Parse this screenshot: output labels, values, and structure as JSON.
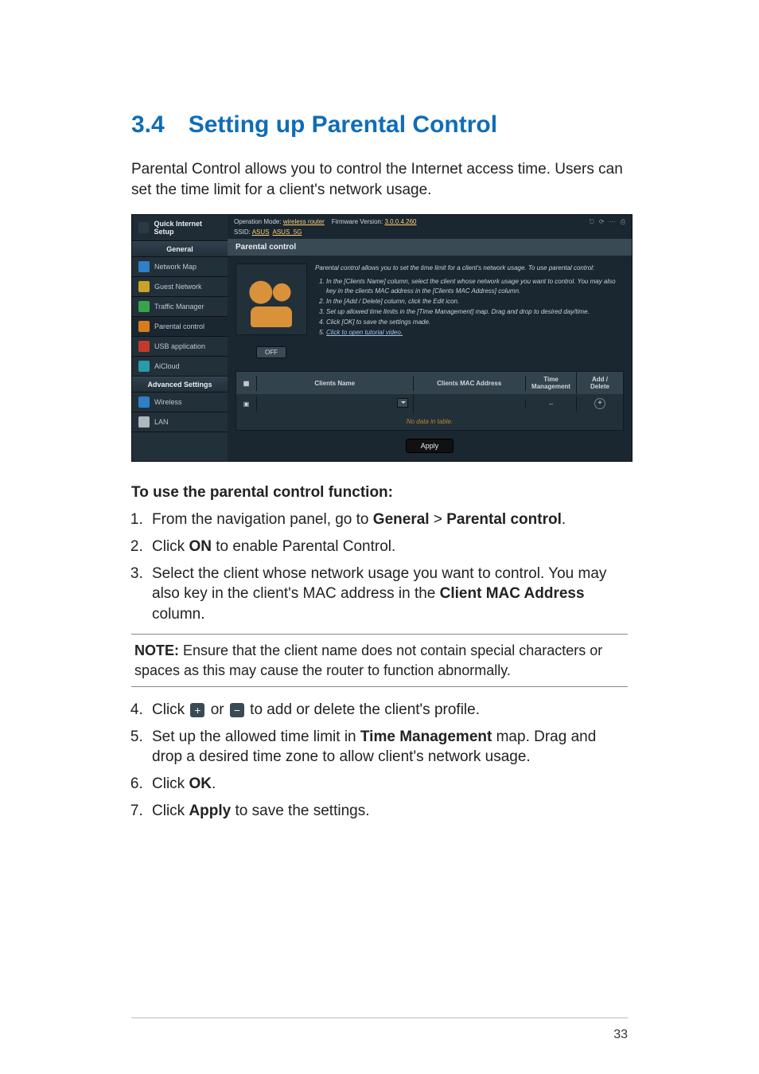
{
  "heading": "3.4 Setting up Parental Control",
  "intro": "Parental Control allows you to control the Internet access time. Users can set the time limit for a client's network usage.",
  "screenshot": {
    "quick_setup": "Quick Internet Setup",
    "header": {
      "op_mode_label": "Operation Mode:",
      "op_mode_value": "wireless router",
      "fw_label": "Firmware Version:",
      "fw_value": "3.0.0.4.260",
      "ssid_label": "SSID:",
      "ssid1": "ASUS",
      "ssid2": "ASUS_5G"
    },
    "sidebar": {
      "general_label": "General",
      "items": [
        "Network Map",
        "Guest Network",
        "Traffic Manager",
        "Parental control",
        "USB application",
        "AiCloud"
      ],
      "advanced_label": "Advanced Settings",
      "adv_items": [
        "Wireless",
        "LAN"
      ]
    },
    "panel_title": "Parental control",
    "desc_intro": "Parental control allows you to set the time limit for a client's network usage. To use parental control:",
    "desc_steps": [
      "In the [Clients Name] column, select the client whose network usage you want to control. You may also key in the clients MAC address in the [Clients MAC Address] column.",
      "In the [Add / Delete] column, click the Edit icon.",
      "Set up allowed time limits in the [Time Management] map. Drag and drop to desired day/time.",
      "Click [OK] to save the settings made.",
      "Click to open tutorial video."
    ],
    "toggle": "OFF",
    "table": {
      "cols": [
        "",
        "Clients Name",
        "Clients MAC Address",
        "Time Management",
        "Add / Delete"
      ],
      "empty": "No data in table.",
      "time_placeholder": "--"
    },
    "apply": "Apply"
  },
  "subhead": "To use the parental control function:",
  "steps_a": [
    {
      "pre": "From the navigation panel, go to ",
      "b1": "General",
      "mid": " > ",
      "b2": "Parental control",
      "post": "."
    },
    {
      "pre": "Click ",
      "b1": "ON",
      "post": " to enable Parental Control."
    },
    {
      "pre": "Select the client whose network usage you want to control. You may also key in the client's MAC address in the ",
      "b1": "Client MAC Address",
      "post": " column."
    }
  ],
  "note": {
    "label": "NOTE:",
    "text": "  Ensure that the client name does not contain special characters or spaces as this may cause the router to function abnormally."
  },
  "steps_b": [
    {
      "n": "4",
      "pre": "Click ",
      "icon1": "+",
      "mid": " or ",
      "icon2": "−",
      "post": " to add or delete the client's profile."
    },
    {
      "n": "5",
      "pre": "Set up the allowed time limit in ",
      "b1": "Time Management",
      "post": " map. Drag and drop a desired time zone to allow client's network usage."
    },
    {
      "n": "6",
      "pre": "Click ",
      "b1": "OK",
      "post": "."
    },
    {
      "n": "7",
      "pre": "Click ",
      "b1": "Apply",
      "post": " to save the settings."
    }
  ],
  "page_number": "33"
}
